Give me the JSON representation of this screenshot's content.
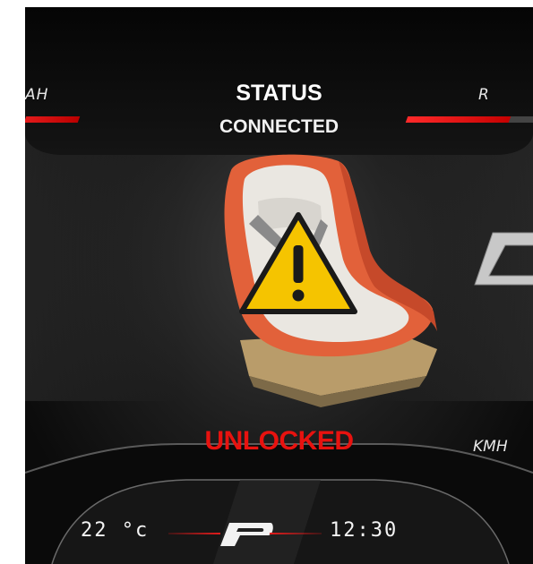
{
  "header": {
    "title": "STATUS",
    "status": "CONNECTED"
  },
  "gears": {
    "left_label": "AH",
    "right_label": "R"
  },
  "seat": {
    "warning_icon": "warning-triangle-icon",
    "lock_state": "UNLOCKED",
    "lock_state_color": "#e8120f"
  },
  "speed": {
    "unit": "KMH"
  },
  "footer": {
    "temperature": "22 °c",
    "clock": "12:30",
    "logo_icon": "p-logo-icon"
  },
  "colors": {
    "accent": "#e31b1b",
    "warning": "#f5c400",
    "background": "#111111"
  }
}
